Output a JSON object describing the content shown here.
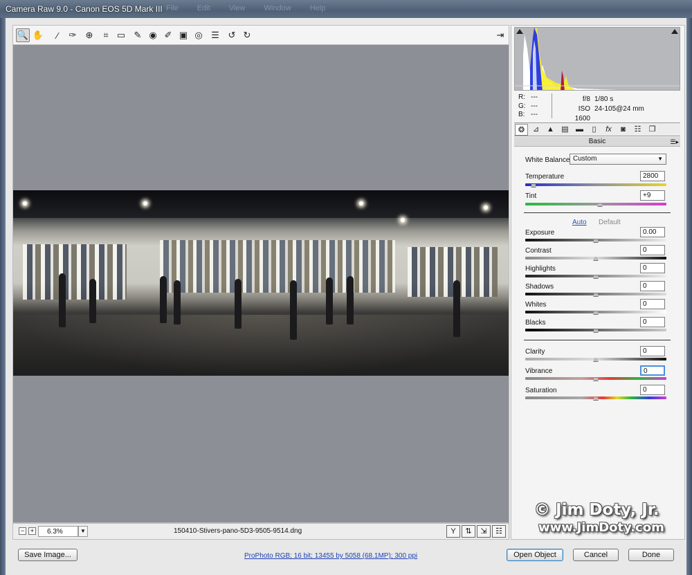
{
  "window": {
    "title": "Camera Raw 9.0  -  Canon EOS 5D Mark III",
    "ghost_menu": [
      "File",
      "Edit",
      "View",
      "Window",
      "Help"
    ]
  },
  "toolbar": {
    "tools": [
      {
        "name": "zoom-tool",
        "icon": "magnifier-icon",
        "glyph": "🔍",
        "active": true
      },
      {
        "name": "hand-tool",
        "icon": "hand-icon",
        "glyph": "✋"
      },
      {
        "name": "white-balance-tool",
        "icon": "eyedropper-icon",
        "glyph": "⁄"
      },
      {
        "name": "color-sampler-tool",
        "icon": "color-sampler-icon",
        "glyph": "✑"
      },
      {
        "name": "targeted-adjustment-tool",
        "icon": "target-icon",
        "glyph": "⊕"
      },
      {
        "name": "crop-tool",
        "icon": "crop-icon",
        "glyph": "⌗"
      },
      {
        "name": "straighten-tool",
        "icon": "straighten-icon",
        "glyph": "▭"
      },
      {
        "name": "spot-removal-tool",
        "icon": "brush-spot-icon",
        "glyph": "✎"
      },
      {
        "name": "red-eye-tool",
        "icon": "eye-icon",
        "glyph": "◉"
      },
      {
        "name": "adjustment-brush-tool",
        "icon": "brush-icon",
        "glyph": "✐"
      },
      {
        "name": "graduated-filter-tool",
        "icon": "graduated-filter-icon",
        "glyph": "▣"
      },
      {
        "name": "radial-filter-tool",
        "icon": "radial-filter-icon",
        "glyph": "◎"
      },
      {
        "name": "preferences-tool",
        "icon": "list-icon",
        "glyph": "☰"
      },
      {
        "name": "rotate-ccw-tool",
        "icon": "rotate-ccw-icon",
        "glyph": "↺"
      },
      {
        "name": "rotate-cw-tool",
        "icon": "rotate-cw-icon",
        "glyph": "↻"
      }
    ],
    "fullscreen_glyph": "⇥"
  },
  "preview": {
    "zoom_value": "6.3%",
    "zoom_minus": "−",
    "zoom_plus": "+",
    "filename": "150410-Stivers-pano-5D3-9505-9514.dng"
  },
  "info": {
    "r_label": "R:",
    "r_value": "---",
    "g_label": "G:",
    "g_value": "---",
    "b_label": "B:",
    "b_value": "---",
    "aperture": "f/8",
    "shutter": "1/80 s",
    "iso": "ISO 1600",
    "lens": "24-105@24 mm"
  },
  "panel": {
    "section_title": "Basic",
    "white_balance_label": "White Balance:",
    "white_balance_value": "Custom",
    "auto_link": "Auto",
    "default_link": "Default",
    "sliders": [
      {
        "key": "temperature",
        "label": "Temperature",
        "value": "2800",
        "pos": 0.06
      },
      {
        "key": "tint",
        "label": "Tint",
        "value": "+9",
        "pos": 0.53
      },
      {
        "key": "exposure",
        "label": "Exposure",
        "value": "0.00",
        "pos": 0.5
      },
      {
        "key": "contrast",
        "label": "Contrast",
        "value": "0",
        "pos": 0.5
      },
      {
        "key": "highlights",
        "label": "Highlights",
        "value": "0",
        "pos": 0.5
      },
      {
        "key": "shadows",
        "label": "Shadows",
        "value": "0",
        "pos": 0.5
      },
      {
        "key": "whites",
        "label": "Whites",
        "value": "0",
        "pos": 0.5
      },
      {
        "key": "blacks",
        "label": "Blacks",
        "value": "0",
        "pos": 0.5
      },
      {
        "key": "clarity",
        "label": "Clarity",
        "value": "0",
        "pos": 0.5
      },
      {
        "key": "vibrance",
        "label": "Vibrance",
        "value": "0",
        "pos": 0.5
      },
      {
        "key": "saturation",
        "label": "Saturation",
        "value": "0",
        "pos": 0.5
      }
    ]
  },
  "watermark": {
    "line1": "© Jim Doty, Jr.",
    "line2": "www.JimDoty.com"
  },
  "footer": {
    "save_label": "Save Image...",
    "workflow_link": "ProPhoto RGB; 16 bit; 13455 by 5058 (68.1MP); 300 ppi",
    "open_label": "Open Object",
    "cancel_label": "Cancel",
    "done_label": "Done"
  },
  "colors": {
    "preview_bg": "#8d8f96",
    "link_blue": "#1d3fb3",
    "panel_bg": "#f4f4f4"
  }
}
